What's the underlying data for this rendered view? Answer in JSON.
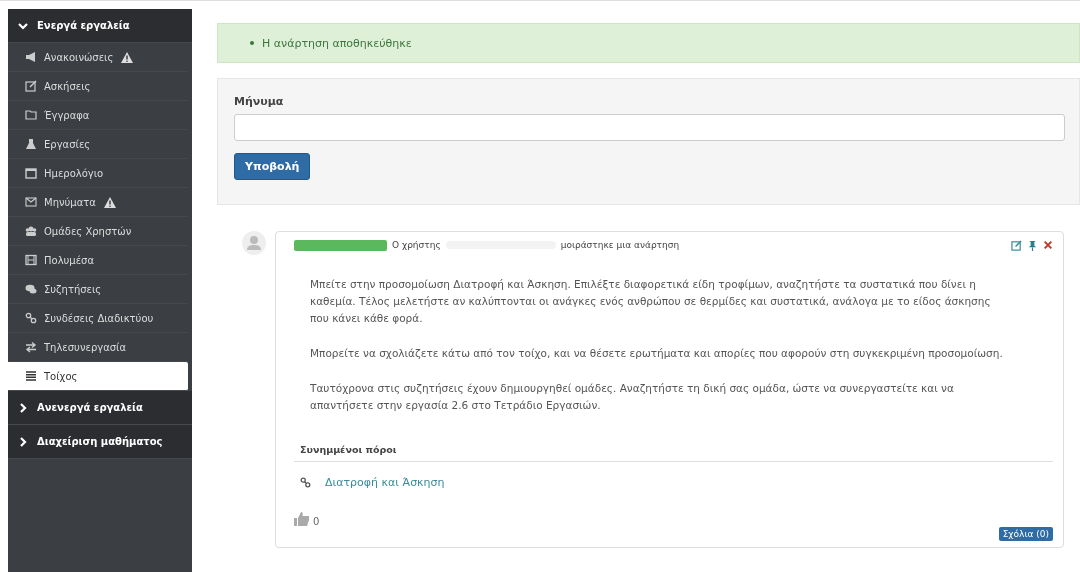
{
  "sidebar": {
    "sections": [
      {
        "label": "Ενεργά εργαλεία",
        "expanded": true,
        "items": [
          {
            "label": "Ανακοινώσεις",
            "warning": true,
            "selected": false
          },
          {
            "label": "Ασκήσεις",
            "warning": false,
            "selected": false
          },
          {
            "label": "Έγγραφα",
            "warning": false,
            "selected": false
          },
          {
            "label": "Εργασίες",
            "warning": false,
            "selected": false
          },
          {
            "label": "Ημερολόγιο",
            "warning": false,
            "selected": false
          },
          {
            "label": "Μηνύματα",
            "warning": true,
            "selected": false
          },
          {
            "label": "Ομάδες Χρηστών",
            "warning": false,
            "selected": false
          },
          {
            "label": "Πολυμέσα",
            "warning": false,
            "selected": false
          },
          {
            "label": "Συζητήσεις",
            "warning": false,
            "selected": false
          },
          {
            "label": "Συνδέσεις Διαδικτύου",
            "warning": false,
            "selected": false
          },
          {
            "label": "Τηλεσυνεργασία",
            "warning": false,
            "selected": false
          },
          {
            "label": "Τοίχος",
            "warning": false,
            "selected": true
          }
        ]
      },
      {
        "label": "Ανενεργά εργαλεία",
        "expanded": false
      },
      {
        "label": "Διαχείριση μαθήματος",
        "expanded": false
      }
    ]
  },
  "alert": {
    "message": "Η ανάρτηση αποθηκεύθηκε"
  },
  "form": {
    "label": "Μήνυμα",
    "submit": "Υποβολή"
  },
  "post": {
    "author_prefix": "Ο χρήστης",
    "action": "μοιράστηκε μια ανάρτηση",
    "paragraphs": [
      "Μπείτε στην προσομοίωση Διατροφή και Άσκηση. Επιλέξτε διαφορετικά είδη τροφίμων, αναζητήστε τα συστατικά που δίνει η καθεμία. Τέλος μελετήστε αν καλύπτονται οι ανάγκες ενός ανθρώπου σε θερμίδες και συστατικά, ανάλογα με το είδος άσκησης που κάνει κάθε φορά.",
      "Μπορείτε να σχολιάζετε κάτω από τον τοίχο, και να θέσετε ερωτήματα και απορίες που αφορούν στη συγκεκριμένη προσομοίωση.",
      "Ταυτόχρονα στις συζητήσεις έχουν δημιουργηθεί ομάδες. Αναζητήστε τη δική σας ομάδα, ώστε να συνεργαστείτε και να απαντήσετε στην εργασία 2.6 στο Τετράδιο Εργασιών."
    ],
    "resources_title": "Συνημμένοι πόροι",
    "resources": [
      "Διατροφή και Άσκηση"
    ],
    "likes": "0",
    "comments": "Σχόλια (0)"
  }
}
